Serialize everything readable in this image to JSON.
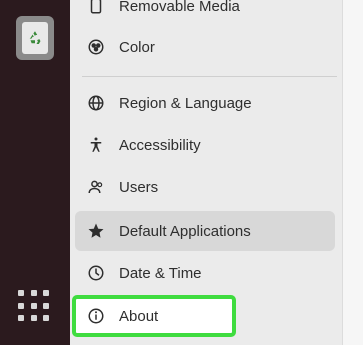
{
  "dock": {
    "trash_icon": "recycle-icon",
    "apps_icon": "show-applications-icon"
  },
  "sidebar": {
    "items": [
      {
        "label": "Removable Media",
        "icon": "media-icon"
      },
      {
        "label": "Color",
        "icon": "color-icon"
      },
      {
        "label": "Region & Language",
        "icon": "globe-icon"
      },
      {
        "label": "Accessibility",
        "icon": "accessibility-icon"
      },
      {
        "label": "Users",
        "icon": "users-icon"
      },
      {
        "label": "Default Applications",
        "icon": "star-icon"
      },
      {
        "label": "Date & Time",
        "icon": "clock-icon"
      },
      {
        "label": "About",
        "icon": "info-icon"
      }
    ]
  },
  "colors": {
    "dock": "#2b1a1e",
    "highlight": "#3fdc3f",
    "active_item": "#d8d8d8"
  }
}
